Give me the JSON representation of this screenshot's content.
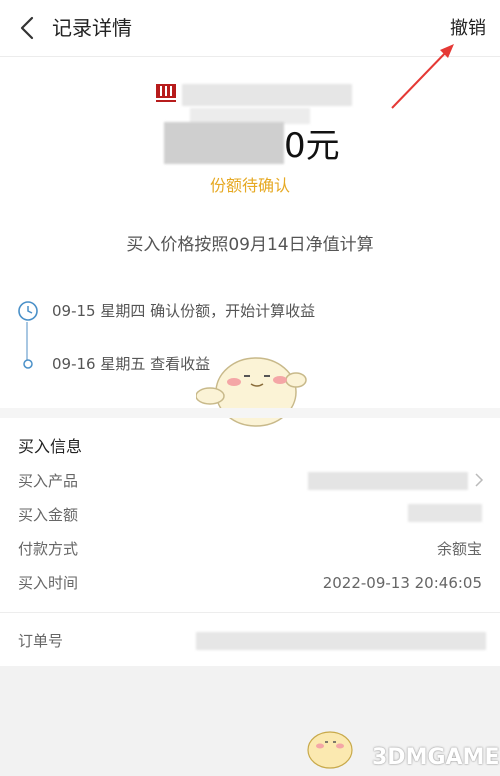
{
  "header": {
    "title": "记录详情",
    "cancel_label": "撤销"
  },
  "summary": {
    "amount_suffix": "0元",
    "status": "份额待确认",
    "price_note": "买入价格按照09月14日净值计算"
  },
  "timeline": [
    {
      "text": "09-15 星期四  确认份额，开始计算收益"
    },
    {
      "text": "09-16 星期五  查看收益"
    }
  ],
  "purchase_info": {
    "title": "买入信息",
    "rows": [
      {
        "label": "买入产品",
        "value": ""
      },
      {
        "label": "买入金额",
        "value": ""
      },
      {
        "label": "付款方式",
        "value": "余额宝"
      },
      {
        "label": "买入时间",
        "value": "2022-09-13 20:46:05"
      }
    ]
  },
  "order": {
    "label": "订单号"
  },
  "watermark": "3DMGAME",
  "colors": {
    "status": "#e6a923",
    "arrow": "#e53935"
  },
  "icons": {
    "back": "chevron-left-icon",
    "timeline_clock": "clock-icon",
    "timeline_dot": "dot-icon",
    "row_chevron": "chevron-right-icon"
  }
}
